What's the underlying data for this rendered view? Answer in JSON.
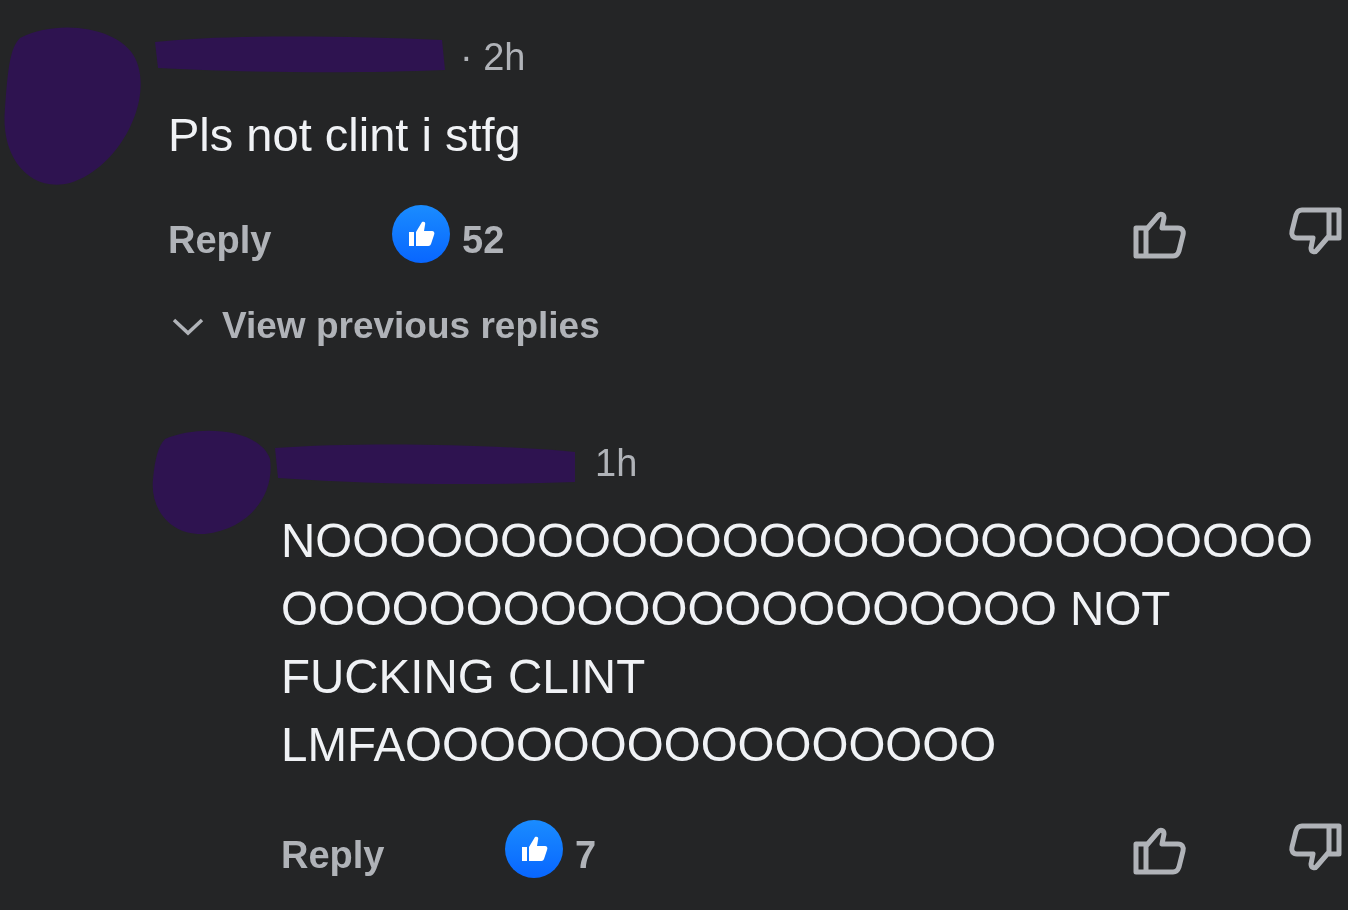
{
  "comment": {
    "time": "· 2h",
    "text": "Pls not clint i stfg",
    "reply_label": "Reply",
    "reaction_count": "52"
  },
  "view_previous_replies": "View previous replies",
  "reply": {
    "time": "1h",
    "text": "NOOOOOOOOOOOOOOOOOOOOOOOOOOOOOOOOOOOOOOOOOOOOOOOO NOT FUCKING CLINT LMFAOOOOOOOOOOOOOOOO",
    "reply_label": "Reply",
    "reaction_count": "7"
  }
}
